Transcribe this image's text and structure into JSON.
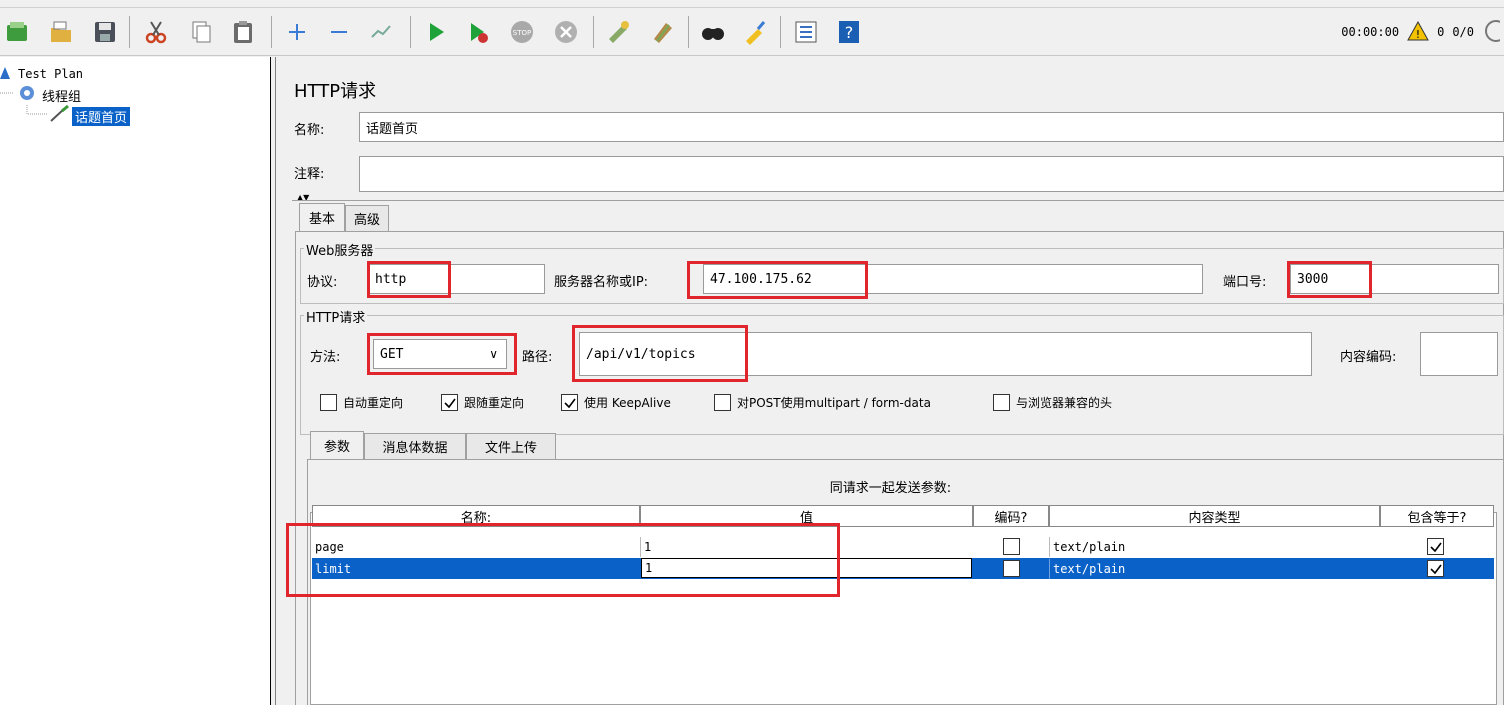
{
  "toolbar": {
    "timer": "00:00:00",
    "warning_count": "0",
    "thread_count": "0/0"
  },
  "tree": {
    "root": "Test Plan",
    "thread_group": "线程组",
    "sampler": "话题首页"
  },
  "panel": {
    "title": "HTTP请求",
    "name_label": "名称:",
    "name_value": "话题首页",
    "comment_label": "注释:",
    "comment_value": "",
    "tabs": [
      "基本",
      "高级"
    ],
    "web_server": {
      "legend": "Web服务器",
      "protocol_label": "协议:",
      "protocol_value": "http",
      "server_label": "服务器名称或IP:",
      "server_value": "47.100.175.62",
      "port_label": "端口号:",
      "port_value": "3000"
    },
    "http_request": {
      "legend": "HTTP请求",
      "method_label": "方法:",
      "method_value": "GET",
      "path_label": "路径:",
      "path_value": "/api/v1/topics",
      "encoding_label": "内容编码:",
      "encoding_value": ""
    },
    "checkboxes": [
      {
        "label": "自动重定向",
        "checked": false
      },
      {
        "label": "跟随重定向",
        "checked": true
      },
      {
        "label": "使用 KeepAlive",
        "checked": true
      },
      {
        "label": "对POST使用multipart / form-data",
        "checked": false
      },
      {
        "label": "与浏览器兼容的头",
        "checked": false
      }
    ],
    "param_tabs": [
      "参数",
      "消息体数据",
      "文件上传"
    ],
    "params_caption": "同请求一起发送参数:",
    "columns": [
      "名称:",
      "值",
      "编码?",
      "内容类型",
      "包含等于?"
    ],
    "rows": [
      {
        "name": "page",
        "value": "1",
        "encode": false,
        "content_type": "text/plain",
        "include_equals": true
      },
      {
        "name": "limit",
        "value": "1",
        "encode": false,
        "content_type": "text/plain",
        "include_equals": true
      }
    ]
  },
  "colors": {
    "selection": "#0a62c8",
    "highlight_box": "#e0262c"
  }
}
